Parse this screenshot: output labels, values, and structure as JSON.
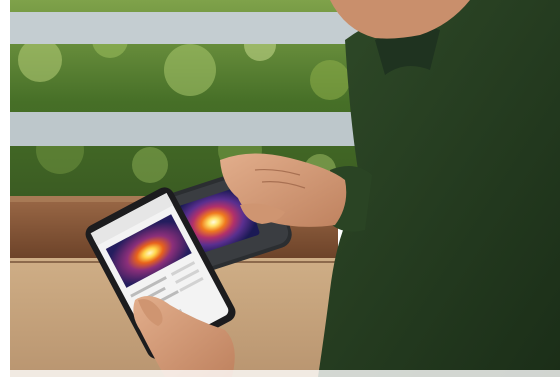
{
  "scene": {
    "subject": "person-using-thermal-camera-with-phone-app",
    "palette": {
      "wall": "#ffffff",
      "foliage": "#4f7a2c",
      "foliage_light": "#8fb04a",
      "rail": "#b9c4c8",
      "sill": "#8a5a3b",
      "shirt": "#23391f",
      "skin": "#d59a78",
      "device": "#2a2d30",
      "phone": "#1c1c1e",
      "thermal_hot": "#ffe36a",
      "thermal_warm": "#f07a1e",
      "thermal_cool": "#5a2f8f",
      "thermal_cold": "#1b1a55"
    }
  },
  "phone_app": {
    "header_text": "",
    "readings": []
  },
  "camera_display": {
    "readout": ""
  }
}
